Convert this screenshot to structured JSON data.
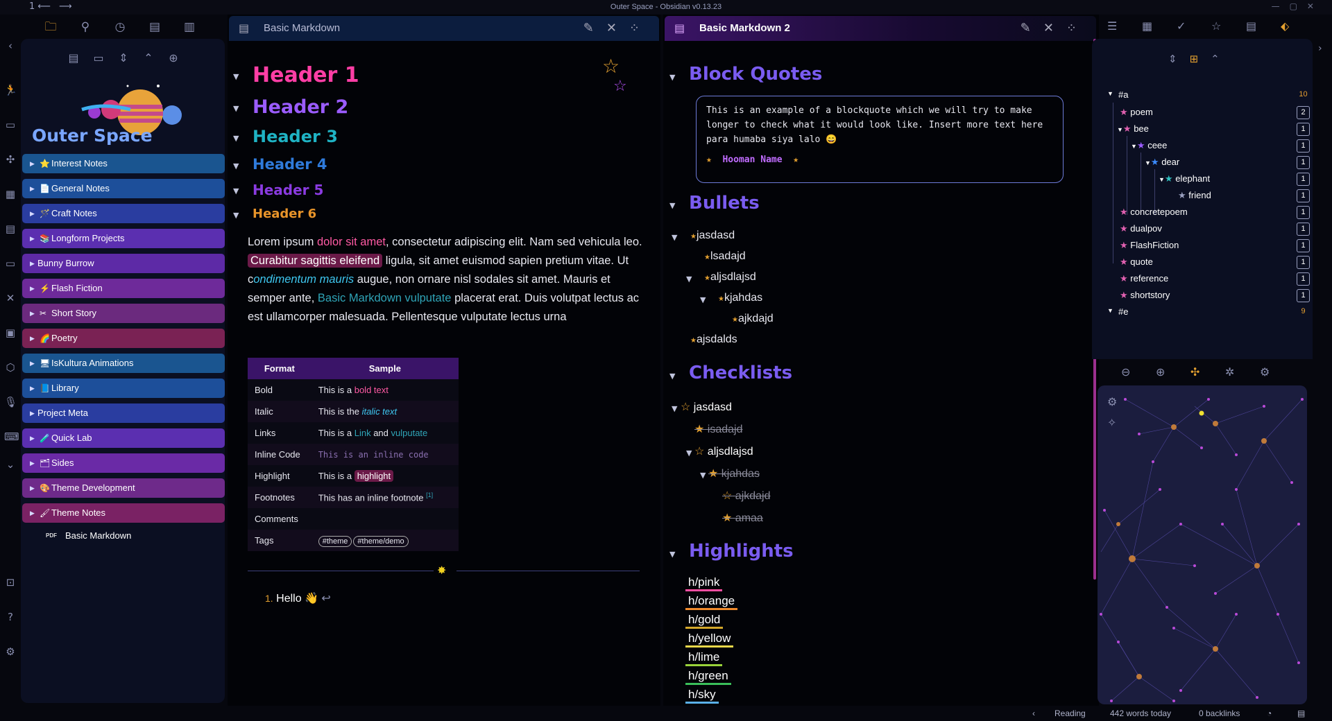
{
  "window": {
    "title": "Outer Space - Obsidian v0.13.23",
    "nav": "1⟵ ⟶"
  },
  "sidebar": {
    "vault_title": "Outer Space",
    "folders": [
      {
        "label": "Interest Notes",
        "icon": "⭐",
        "color": "#1a5590"
      },
      {
        "label": "General Notes",
        "icon": "📄",
        "color": "#1d4f9a"
      },
      {
        "label": "Craft Notes",
        "icon": "🪄",
        "color": "#2a3da0"
      },
      {
        "label": "Longform Projects",
        "icon": "📚",
        "color": "#5b2fb0"
      },
      {
        "label": "Bunny Burrow",
        "icon": "",
        "color": "#5d2aa6"
      },
      {
        "label": "Flash Fiction",
        "icon": "⚡",
        "color": "#6e2a9a"
      },
      {
        "label": "Short Story",
        "icon": "✂",
        "color": "#6b2a7e"
      },
      {
        "label": "Poetry",
        "icon": "🌈",
        "color": "#7a2254"
      },
      {
        "label": "IsKultura Animations",
        "icon": "🖥",
        "color": "#1a5590"
      },
      {
        "label": "Library",
        "icon": "📘",
        "color": "#1d4f9a"
      },
      {
        "label": "Project Meta",
        "icon": "",
        "color": "#2a3da0"
      },
      {
        "label": "Quick Lab",
        "icon": "🧪",
        "color": "#5b2fb0"
      },
      {
        "label": "Sides",
        "icon": "🗂",
        "color": "#6a2aa6"
      },
      {
        "label": "Theme Development",
        "icon": "🎨",
        "color": "#6e2a8a"
      },
      {
        "label": "Theme Notes",
        "icon": "🖌",
        "color": "#7a2264"
      }
    ],
    "file": {
      "badge": "PDF",
      "label": "Basic Markdown"
    }
  },
  "pane1": {
    "tab_title": "Basic Markdown",
    "headers": [
      {
        "text": "Header 1",
        "color": "#ff3ea5"
      },
      {
        "text": "Header 2",
        "color": "#9b5cff"
      },
      {
        "text": "Header 3",
        "color": "#1fb3c4"
      },
      {
        "text": "Header 4",
        "color": "#2f7bdb"
      },
      {
        "text": "Header 5",
        "color": "#8a3be0"
      },
      {
        "text": "Header 6",
        "color": "#e8942a"
      }
    ],
    "para": {
      "p1": "Lorem ipsum ",
      "p2": "dolor sit amet",
      "p3": ", consectetur adipiscing elit. Nam sed vehicula leo. ",
      "p4": "Curabitur sagittis eleifend",
      "p5": " ligula, sit amet euismod sapien pretium vitae. Ut c",
      "p6": "ondimentum mauris",
      "p7": " augue, non ornare nisl sodales sit amet. Mauris et semper ante, ",
      "p8": "Basic Markdown vulputate",
      "p9": " placerat erat. Duis volutpat lectus ac est ullamcorper malesuada. Pellentesque vulputate lectus urna"
    },
    "table": {
      "headers": [
        "Format",
        "Sample"
      ],
      "rows": {
        "bold": {
          "label": "Bold",
          "pre": "This is a ",
          "val": "bold text"
        },
        "italic": {
          "label": "Italic",
          "pre": "This is the ",
          "val": "italic text"
        },
        "links": {
          "label": "Links",
          "pre": "This is a ",
          "l1": "Link",
          "mid": " and ",
          "l2": "vulputate"
        },
        "code": {
          "label": "Inline Code",
          "val": "This is an inline code"
        },
        "highlight": {
          "label": "Highlight",
          "pre": "This is a ",
          "val": "highlight"
        },
        "footnotes": {
          "label": "Footnotes",
          "pre": "This has an inline footnote ",
          "sup": "[1]"
        },
        "comments": {
          "label": "Comments"
        },
        "tags": {
          "label": "Tags",
          "t1": "#theme",
          "t2": "#theme/demo"
        }
      }
    },
    "list": {
      "num": "1.",
      "text": "Hello 👋",
      "ret": "↩"
    }
  },
  "pane2": {
    "tab_title": "Basic Markdown 2",
    "h_bq": "Block Quotes",
    "h_bul": "Bullets",
    "h_chk": "Checklists",
    "h_hl": "Highlights",
    "quote": "This is an example of a blockquote which we will try to make longer to check what it would look like. Insert more text here para humaba siya lalo 😄",
    "quote_author": "Hooman Name",
    "bullets": [
      "jasdasd",
      "lsadajd",
      "aljsdlajsd",
      "kjahdas",
      "ajkdajd",
      "ajsdalds"
    ],
    "checks": [
      "jasdasd",
      "isadajd",
      "aljsdlajsd",
      "kjahdas",
      "ajkdajd",
      "amaa"
    ],
    "highlights": [
      {
        "text": "h/pink",
        "color": "#ff4fa3"
      },
      {
        "text": "h/orange",
        "color": "#f08a2c"
      },
      {
        "text": "h/gold",
        "color": "#d4a82a"
      },
      {
        "text": "h/yellow",
        "color": "#e8d84a"
      },
      {
        "text": "h/lime",
        "color": "#9ad43a"
      },
      {
        "text": "h/green",
        "color": "#3abf5a"
      },
      {
        "text": "h/sky",
        "color": "#5ab0e8"
      }
    ]
  },
  "tags": {
    "groups": [
      {
        "label": "#a",
        "count": "10"
      },
      {
        "label": "#e",
        "count": "9"
      }
    ],
    "items": [
      {
        "label": "poem",
        "count": "2"
      },
      {
        "label": "bee",
        "count": "1"
      },
      {
        "label": "ceee",
        "count": "1"
      },
      {
        "label": "dear",
        "count": "1"
      },
      {
        "label": "elephant",
        "count": "1"
      },
      {
        "label": "friend",
        "count": "1"
      },
      {
        "label": "concretepoem",
        "count": "1"
      },
      {
        "label": "dualpov",
        "count": "1"
      },
      {
        "label": "FlashFiction",
        "count": "1"
      },
      {
        "label": "quote",
        "count": "1"
      },
      {
        "label": "reference",
        "count": "1"
      },
      {
        "label": "shortstory",
        "count": "1"
      }
    ]
  },
  "status": {
    "mode": "Reading",
    "words": "442 words today",
    "backlinks": "0 backlinks"
  }
}
